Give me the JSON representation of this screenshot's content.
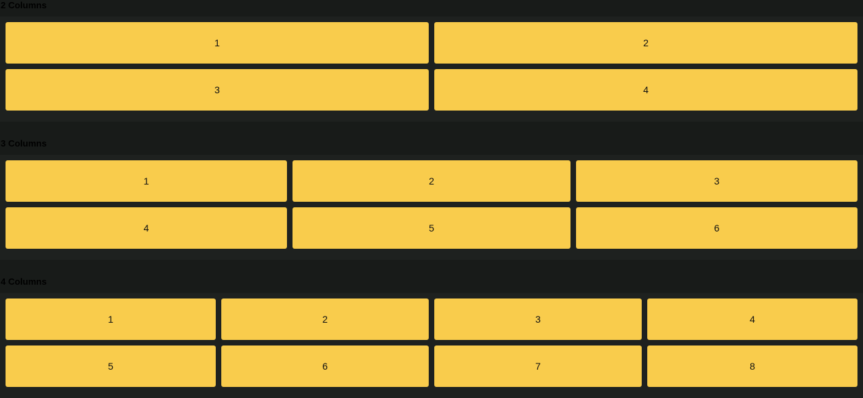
{
  "sections": [
    {
      "title": "2 Columns",
      "items": [
        "1",
        "2",
        "3",
        "4"
      ]
    },
    {
      "title": "3 Columns",
      "items": [
        "1",
        "2",
        "3",
        "4",
        "5",
        "6"
      ]
    },
    {
      "title": "4 Columns",
      "items": [
        "1",
        "2",
        "3",
        "4",
        "5",
        "6",
        "7",
        "8"
      ]
    }
  ],
  "colors": {
    "page_background": "#181b19",
    "panel_background": "#1e211f",
    "item_background": "#f9cc4c",
    "item_text": "#111111"
  }
}
